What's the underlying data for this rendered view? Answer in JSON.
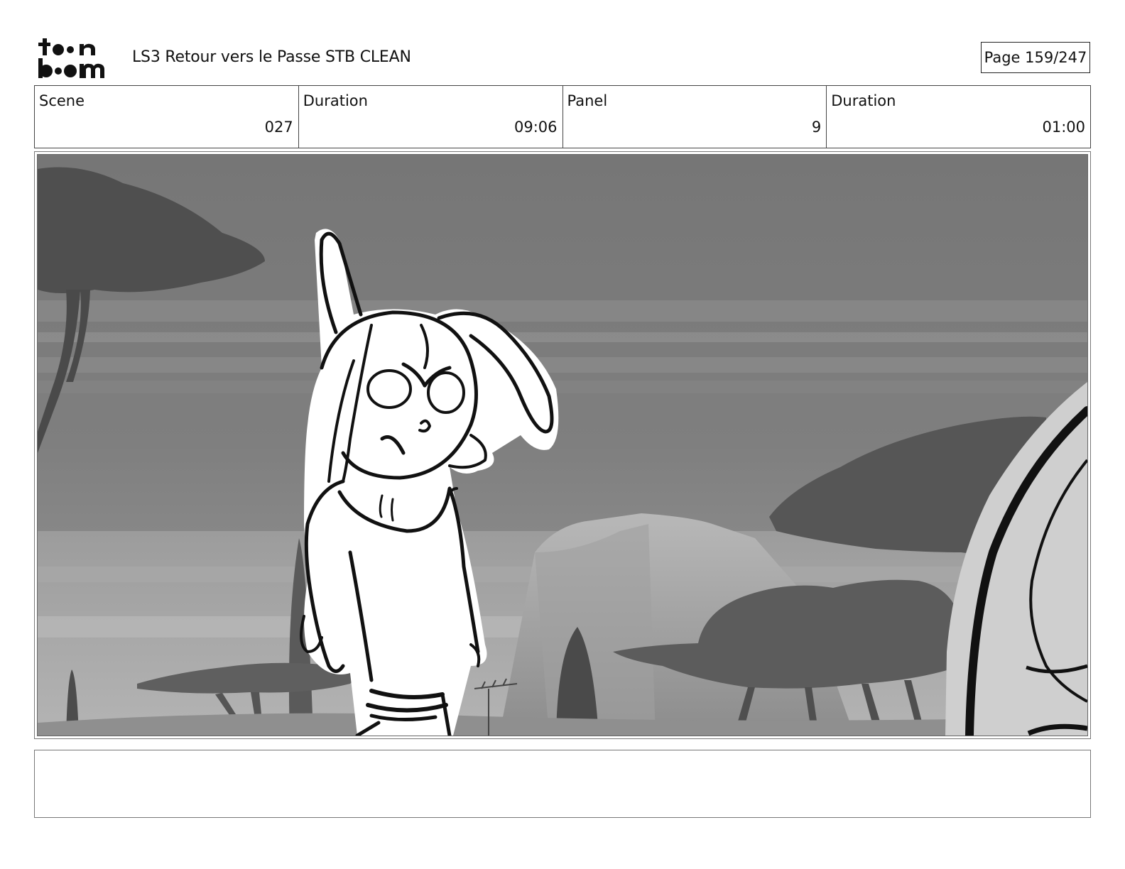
{
  "header": {
    "logo_text": "toon boom",
    "document_title": "LS3 Retour vers le Passe STB CLEAN",
    "page_label": "Page 159/247"
  },
  "info": {
    "scene_label": "Scene",
    "scene_value": "027",
    "scene_duration_label": "Duration",
    "scene_duration_value": "09:06",
    "panel_label": "Panel",
    "panel_value": "9",
    "panel_duration_label": "Duration",
    "panel_duration_value": "01:00"
  },
  "notes": {
    "text": ""
  }
}
